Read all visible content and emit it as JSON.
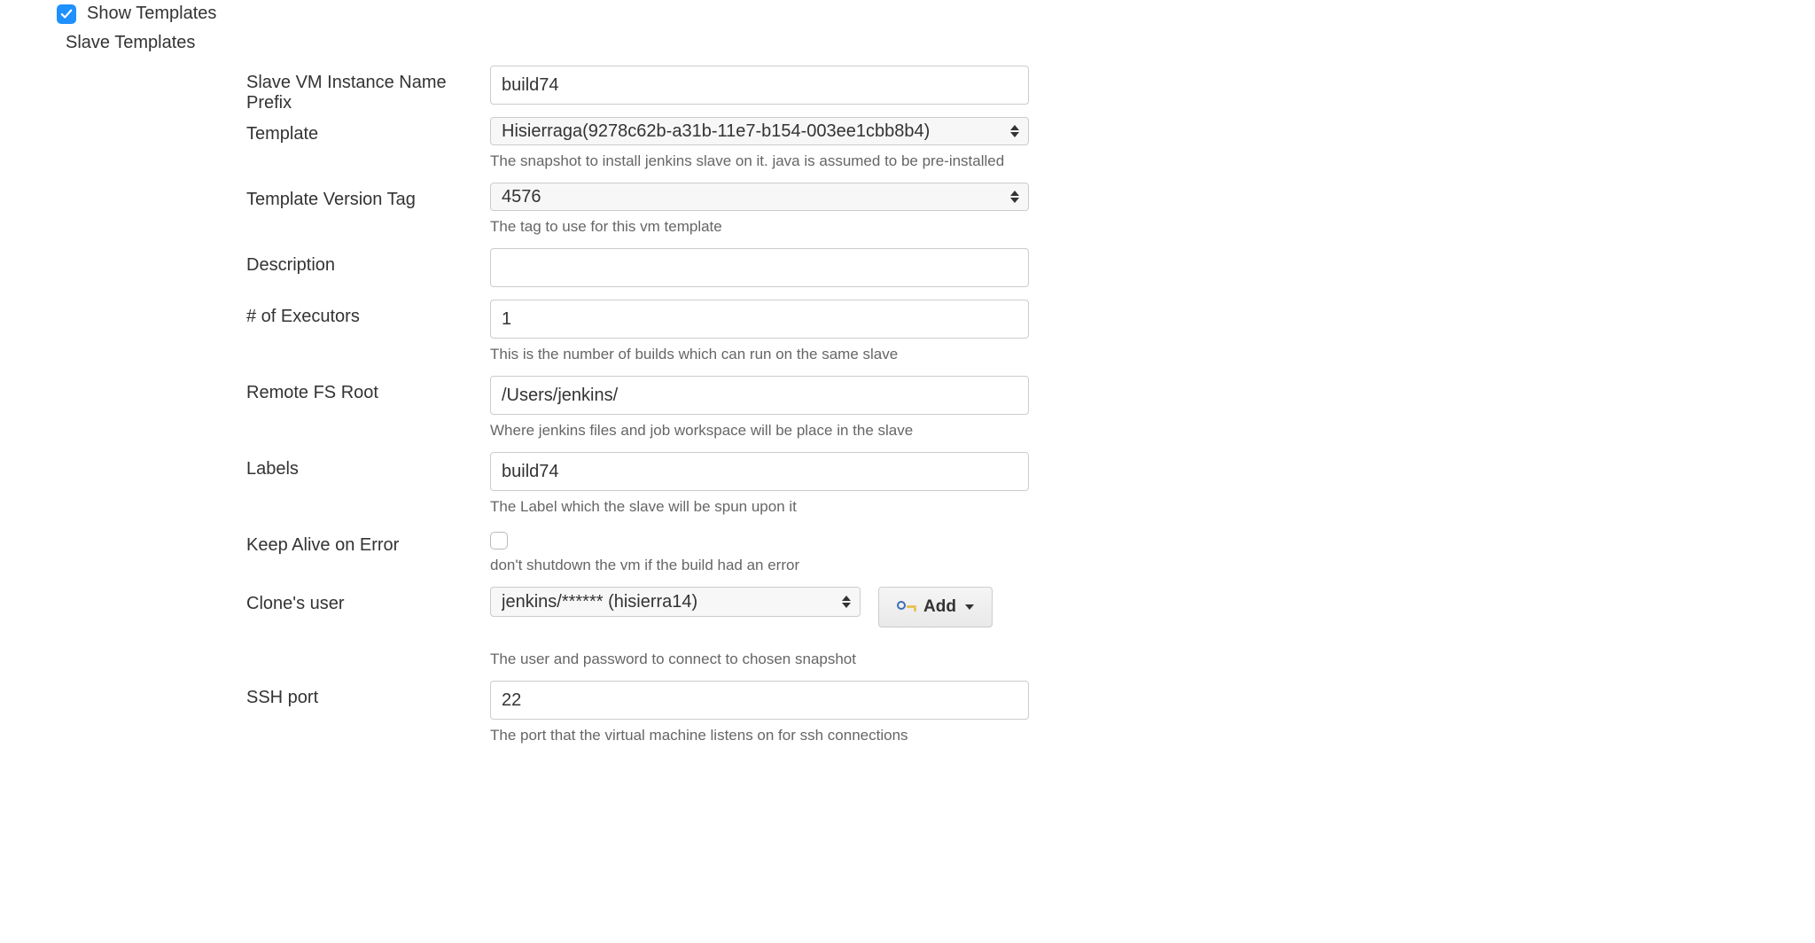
{
  "show_templates": {
    "label": "Show Templates",
    "checked": true
  },
  "section_title": "Slave Templates",
  "fields": {
    "prefix": {
      "label": "Slave VM Instance Name Prefix",
      "value": "build74"
    },
    "template": {
      "label": "Template",
      "value": "Hisierraga(9278c62b-a31b-11e7-b154-003ee1cbb8b4)",
      "help": "The snapshot to install jenkins slave on it. java is assumed to be pre-installed"
    },
    "version": {
      "label": "Template Version Tag",
      "value": "4576",
      "help": "The tag to use for this vm template"
    },
    "description": {
      "label": "Description",
      "value": ""
    },
    "executors": {
      "label": "# of Executors",
      "value": "1",
      "help": "This is the number of builds which can run on the same slave"
    },
    "fsroot": {
      "label": "Remote FS Root",
      "value": "/Users/jenkins/",
      "help": "Where jenkins files and job workspace will be place in the slave"
    },
    "labels": {
      "label": "Labels",
      "value": "build74",
      "help": "The Label which the slave will be spun upon it"
    },
    "keepalive": {
      "label": "Keep Alive on Error",
      "checked": false,
      "help": "don't shutdown the vm if the build had an error"
    },
    "cloneuser": {
      "label": "Clone's user",
      "value": "jenkins/****** (hisierra14)",
      "help": "The user and password to connect to chosen snapshot",
      "add_label": "Add"
    },
    "sshport": {
      "label": "SSH port",
      "value": "22",
      "help": "The port that the virtual machine listens on for ssh connections"
    }
  }
}
